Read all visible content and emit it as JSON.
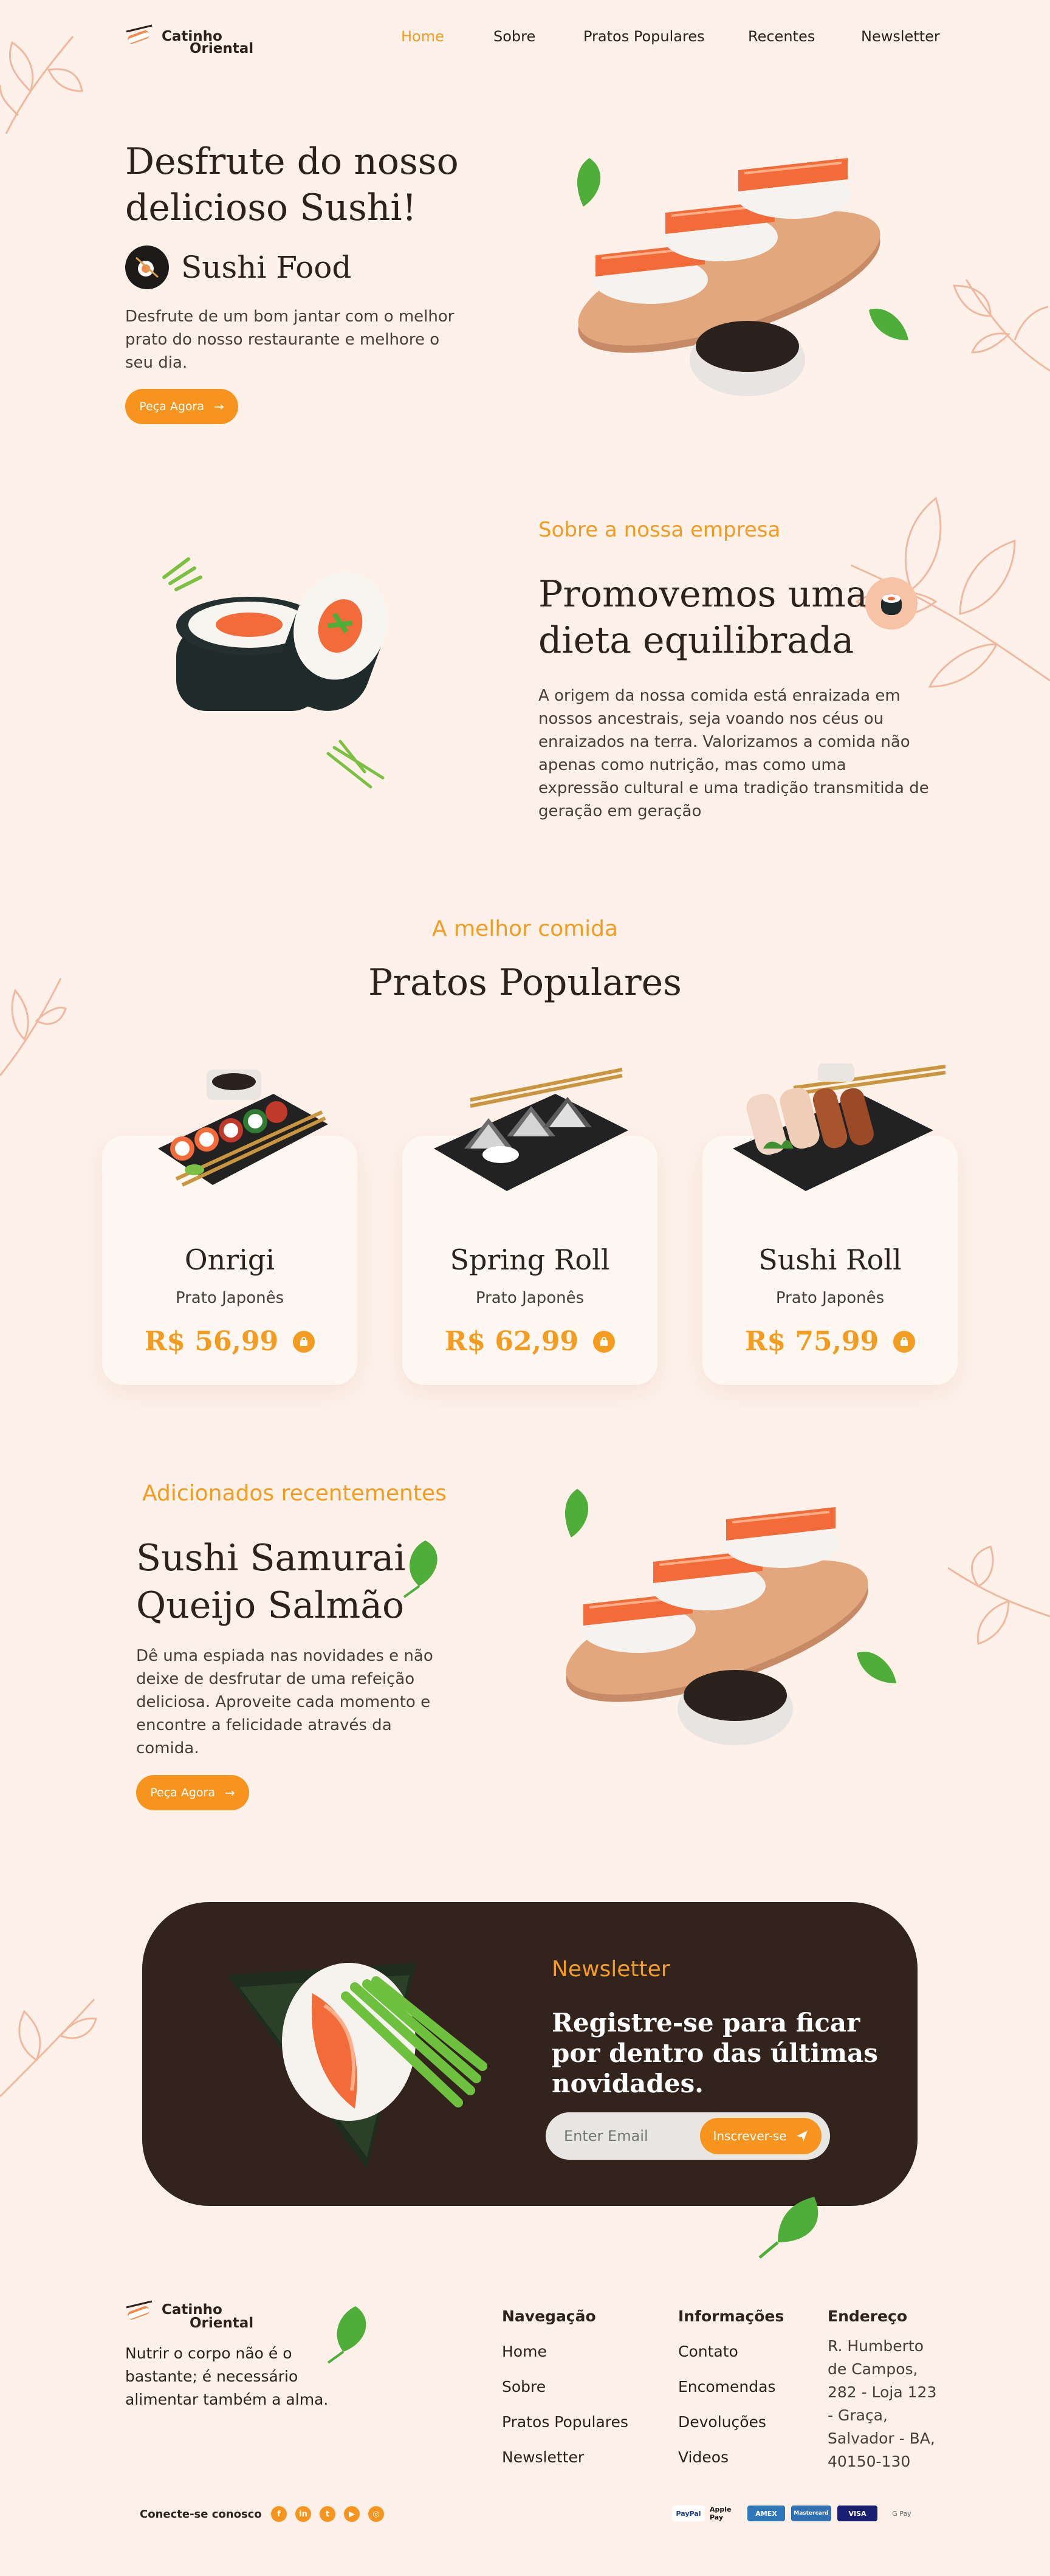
{
  "brand": {
    "name_line1": "Catinho",
    "name_line2": "Oriental"
  },
  "nav": {
    "items": [
      "Home",
      "Sobre",
      "Pratos Populares",
      "Recentes",
      "Newsletter"
    ],
    "active": "Home"
  },
  "hero": {
    "title_line1": "Desfrute do nosso",
    "title_line2": "delicioso Sushi!",
    "badge": "Sushi Food",
    "desc_line1": "Desfrute de um bom jantar com o melhor",
    "desc_line2": "prato do nosso restaurante e melhore o",
    "desc_line3": "seu dia.",
    "cta": "Peça Agora"
  },
  "about": {
    "eyebrow": "Sobre a nossa empresa",
    "title_line1": "Promovemos uma",
    "title_line2": "dieta equilibrada",
    "text_lines": [
      "A origem da nossa comida está enraizada em",
      "nossos ancestrais, seja voando nos céus ou",
      "enraizados na terra. Valorizamos a comida não",
      "apenas como nutrição, mas como uma",
      "expressão cultural e uma tradição transmitida de",
      "geração em geração"
    ]
  },
  "popular": {
    "eyebrow": "A melhor comida",
    "title": "Pratos Populares",
    "cards": [
      {
        "name": "Onrigi",
        "category": "Prato Japonês",
        "price": "R$ 56,99"
      },
      {
        "name": "Spring Roll",
        "category": "Prato Japonês",
        "price": "R$ 62,99"
      },
      {
        "name": "Sushi Roll",
        "category": "Prato Japonês",
        "price": "R$ 75,99"
      }
    ]
  },
  "recent": {
    "eyebrow": "Adicionados recentementes",
    "title_line1": "Sushi Samurai",
    "title_line2": "Queijo Salmão",
    "text_lines": [
      "Dê uma espiada nas novidades e não",
      "deixe de desfrutar de uma refeição",
      "deliciosa. Aproveite cada momento e",
      "encontre a felicidade através da",
      "comida."
    ],
    "cta": "Peça Agora"
  },
  "newsletter": {
    "eyebrow": "Newsletter",
    "title_line1": "Registre-se para ficar",
    "title_line2": "por dentro das últimas",
    "title_line3": "novidades.",
    "placeholder": "Enter Email",
    "button": "Inscrever-se"
  },
  "footer": {
    "tagline_lines": [
      "Nutrir o corpo não é o",
      "bastante; é necessário",
      "alimentar também a alma."
    ],
    "nav_title": "Navegação",
    "nav_links": [
      "Home",
      "Sobre",
      "Pratos Populares",
      "Newsletter"
    ],
    "info_title": "Informações",
    "info_links": [
      "Contato",
      "Encomendas",
      "Devoluções",
      "Videos"
    ],
    "address_title": "Endereço",
    "address_lines": [
      "R. Humberto",
      "de Campos,",
      "282 - Loja 123",
      "- Graça,",
      "Salvador - BA,",
      "40150-130"
    ],
    "connect": "Conecte-se conosco",
    "payments": [
      "PayPal",
      "Apple Pay",
      "AMEX",
      "Mastercard",
      "VISA",
      "G Pay"
    ]
  },
  "colors": {
    "accent": "#f7941d",
    "background": "#fdf1ea",
    "dark": "#2e211c"
  }
}
